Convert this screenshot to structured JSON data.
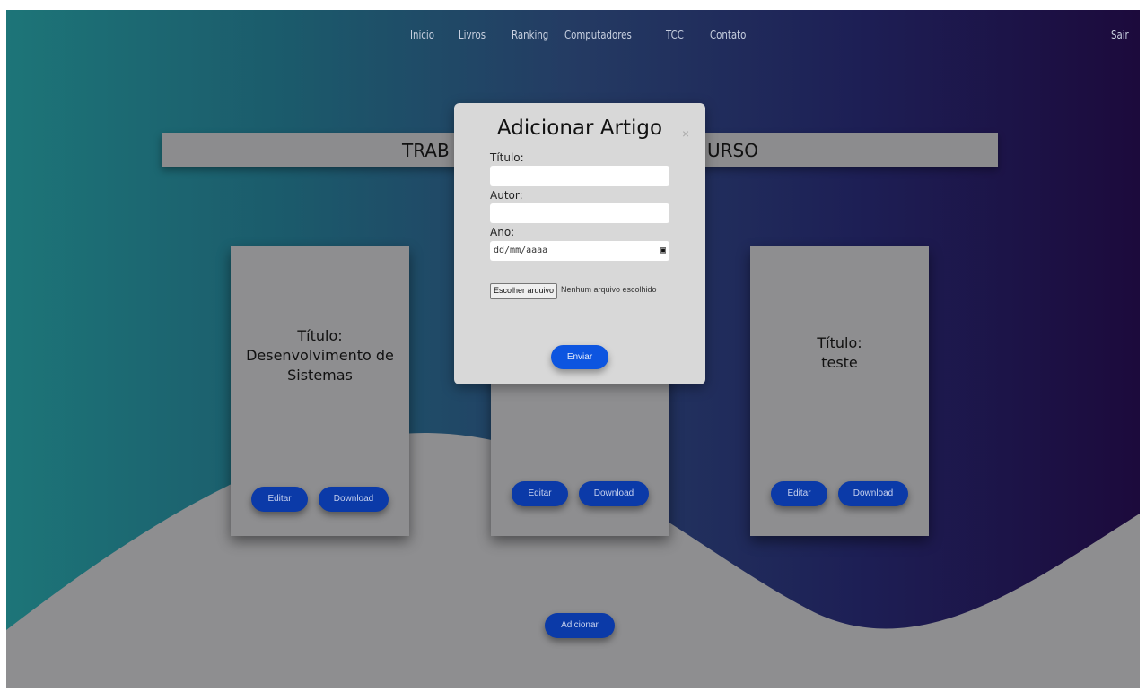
{
  "nav": {
    "items": [
      "Início",
      "Livros",
      "Ranking",
      "Computadores",
      "TCC",
      "Contato"
    ],
    "logout": "Sair"
  },
  "banner": {
    "left_text": "TRAB",
    "right_text": "URSO"
  },
  "cards": [
    {
      "title_label": "Título:",
      "title_value": "Desenvolvimento de Sistemas",
      "edit": "Editar",
      "download": "Download"
    },
    {
      "edit": "Editar",
      "download": "Download"
    },
    {
      "title_label": "Título:",
      "title_value": "teste",
      "edit": "Editar",
      "download": "Download"
    }
  ],
  "add_button": "Adicionar",
  "modal": {
    "title": "Adicionar Artigo",
    "close": "×",
    "fields": {
      "titulo": {
        "label": "Título:",
        "value": ""
      },
      "autor": {
        "label": "Autor:",
        "value": ""
      },
      "ano": {
        "label": "Ano:",
        "placeholder": "dd/mm/aaaa"
      }
    },
    "file": {
      "button": "Escolher arquivo",
      "status": "Nenhum arquivo escolhido"
    },
    "submit": "Enviar"
  },
  "colors": {
    "gradient_left": "#1d7578",
    "gradient_right": "#1c0a3c",
    "wave": "#8e8e90",
    "button_dark": "#0b3aa8",
    "button_primary": "#0d55e0",
    "modal_bg": "#d8d8d8"
  }
}
